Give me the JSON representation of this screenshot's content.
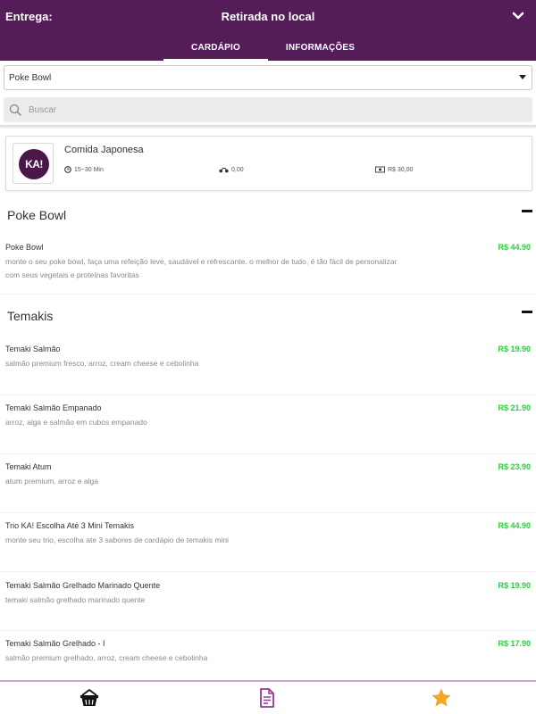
{
  "header": {
    "delivery_label": "Entrega:",
    "pickup_title": "Retirada no local",
    "tabs": [
      {
        "label": "CARDÁPIO",
        "active": true
      },
      {
        "label": "INFORMAÇÕES",
        "active": false
      }
    ],
    "background": "#541d59"
  },
  "category_select": {
    "value": "Poke Bowl"
  },
  "search": {
    "placeholder": "Buscar"
  },
  "store": {
    "logo_text": "KA!",
    "name": "Comida Japonesa",
    "time": "15~30 Min",
    "delivery_fee": "0,00",
    "min_order": "R$ 30,00"
  },
  "sections": [
    {
      "title": "Poke Bowl",
      "items": [
        {
          "name": "Poke Bowl",
          "description": "monte o seu poke bowl, faça uma refeição leve, saudável e refrescante. o melhor de tudo, é tão fácil de personalizar com seus vegetais e proteínas favoritas",
          "price": "R$ 44.90"
        }
      ]
    },
    {
      "title": "Temakis",
      "items": [
        {
          "name": "Temaki Salmão",
          "description": "salmão premium fresco, arroz, cream cheese e cebolinha",
          "price": "R$ 19.90"
        },
        {
          "name": "Temaki Salmão Empanado",
          "description": "arroz, alga e salmão em cubos empanado",
          "price": "R$ 21.90"
        },
        {
          "name": "Temaki Atum",
          "description": "atum premium, arroz e alga",
          "price": "R$ 23.90"
        },
        {
          "name": "Trio KA! Escolha Até 3 Mini Temakis",
          "description": "monte seu trio, escolha ate 3 sabores de cardápio de temakis mini",
          "price": "R$ 44.90"
        },
        {
          "name": "Temaki Salmão Grelhado Marinado Quente",
          "description": "temaki salmão grelhado marinado quente",
          "price": "R$ 19.90"
        },
        {
          "name": "Temaki Salmão Grelhado - I",
          "description": "salmão premium grelhado, arroz, cream cheese e cebolinha",
          "price": "R$ 17.90"
        }
      ]
    }
  ],
  "bottom_nav": [
    {
      "icon": "basket-icon",
      "color": "#111111"
    },
    {
      "icon": "document-icon",
      "color": "#8e3b91"
    },
    {
      "icon": "star-icon",
      "color": "#f5a623"
    }
  ],
  "colors": {
    "price": "#2ecc40",
    "accent": "#541d59"
  }
}
